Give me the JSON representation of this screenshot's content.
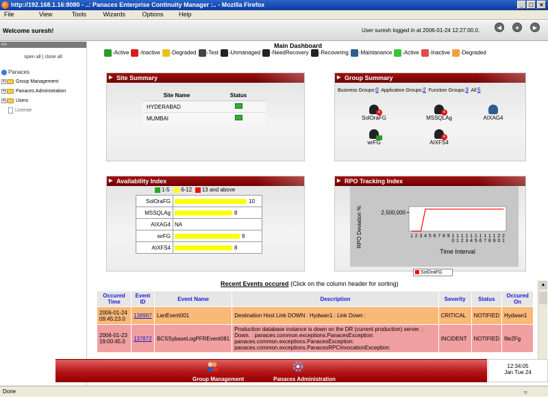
{
  "window": {
    "title": "http://192.168.1.16:8080 - ..: Panaces Enterprise Continuity Manager :.. - Mozilla Firefox"
  },
  "menu": [
    "File",
    "View",
    "Tools",
    "Wizards",
    "Options",
    "Help"
  ],
  "header": {
    "welcome": "Welcome suresh!",
    "login_info": "User suresh logged in at 2006-01-24 12:27:00.0."
  },
  "sidebar": {
    "strip": "<>",
    "open_all": "open all",
    "separator": "|",
    "close_all": "close all",
    "root": "Panaces",
    "items": [
      {
        "label": "Group Management"
      },
      {
        "label": "Panaces Administration"
      },
      {
        "label": "Users"
      },
      {
        "label": "License"
      }
    ]
  },
  "dashboard": {
    "title": "Main Dashboard",
    "legend": [
      {
        "label": "-Active",
        "color": "#2c9a2c"
      },
      {
        "label": "-Inactive",
        "color": "#d81b1b"
      },
      {
        "label": "-Degraded",
        "color": "#e6c21a"
      },
      {
        "label": "-Test",
        "color": "#444444"
      },
      {
        "label": "-Unmanaged",
        "color": "#222222"
      },
      {
        "label": "-NeedRecovery",
        "color": "#222222"
      },
      {
        "label": "-Recovering",
        "color": "#222222"
      },
      {
        "label": "-Maintanance",
        "color": "#2e5c8f"
      },
      {
        "label": "-Active",
        "color": "#37c537"
      },
      {
        "label": "-Inactive",
        "color": "#e24a4a"
      },
      {
        "label": "-Degraded",
        "color": "#f0a040"
      }
    ]
  },
  "site_summary": {
    "title": "Site Summary",
    "col_site": "Site Name",
    "col_status": "Status",
    "rows": [
      {
        "name": "HYDERABAD",
        "status_icon": "active-site-icon"
      },
      {
        "name": "MUMBAI",
        "status_icon": "active-site-icon"
      }
    ]
  },
  "group_summary": {
    "title": "Group Summary",
    "business_label": "Business Groups:",
    "business_count": "0",
    "application_label": "Application Groups:",
    "application_count": "2",
    "function_label": "Function Groups:",
    "function_count": "3",
    "all_label": "All:",
    "all_count": "5",
    "groups": [
      {
        "name": "SolOraFG",
        "state": "inactive"
      },
      {
        "name": "MSSQLAg",
        "state": "inactive"
      },
      {
        "name": "AIXAG4",
        "state": "maintanance"
      },
      {
        "name": "wrFG",
        "state": "active"
      },
      {
        "name": "AIXFS4",
        "state": "inactive"
      }
    ]
  },
  "availability": {
    "title": "Availability Index",
    "legend": [
      {
        "label": "1-5",
        "color": "#22aa22"
      },
      {
        "label": "6-12",
        "color": "#ffff00"
      },
      {
        "label": "13 and above",
        "color": "#ee1111"
      }
    ],
    "rows": [
      {
        "name": "SolOraFG",
        "value": 10,
        "label": "10"
      },
      {
        "name": "MSSQLAg",
        "value": 8,
        "label": "8"
      },
      {
        "name": "AIXAG4",
        "value": null,
        "label": "NA"
      },
      {
        "name": "wrFG",
        "value": 9,
        "label": "9"
      },
      {
        "name": "AIXFS4",
        "value": 8,
        "label": "8"
      }
    ]
  },
  "chart_data": {
    "type": "line",
    "title": "RPO Tracking Index",
    "xlabel": "Time Interval",
    "ylabel": "RPO Deviation %",
    "ytick": "2,500,000",
    "x": [
      "1",
      "2",
      "3",
      "4",
      "5",
      "6",
      "7",
      "8",
      "9",
      "10",
      "11",
      "12",
      "13",
      "14",
      "15",
      "16",
      "17",
      "18",
      "19",
      "20",
      "21"
    ],
    "series": [
      {
        "name": "SolOraFG",
        "color": "#ff0000",
        "values": [
          0,
          0,
          0,
          2950000,
          2950000,
          2950000,
          2950000,
          2950000,
          2950000,
          2950000,
          2950000,
          2950000,
          2950000,
          2950000,
          2950000,
          2950000,
          2950000,
          2950000,
          2950000,
          2950000,
          2950000
        ]
      }
    ],
    "ylim": [
      0,
      3300000
    ],
    "grid": false,
    "legend": "bottom"
  },
  "events": {
    "title": "Recent Events occured",
    "hint": "(Click on the column header for sorting)",
    "columns": [
      "Occured Time",
      "Event ID",
      "Event Name",
      "Description",
      "Severity",
      "Status",
      "Occured On"
    ],
    "rows": [
      {
        "time": "2006-01-24 09:45:23.0",
        "id": "138987",
        "name": "LanEvent001",
        "description": "Destination Host Link DOWN : Hydwan1 : Link Down :",
        "severity": "CRITICAL",
        "status": "NOTIFIED",
        "on": "Hydwan1"
      },
      {
        "time": "2006-01-23 19:00:45.0",
        "id": "137872",
        "name": "BCSSybaseLogPFREvent081",
        "description": "Production database instance is down on the DR (current production) server. : Down. : panaces.common.exceptions.PanacesException: panaces.common.exceptions.PanacesException: panaces.common.exceptions.PanacesRPCInvocationException:",
        "severity": "INCIDENT",
        "status": "NOTIFIED",
        "on": "file2Fg"
      }
    ]
  },
  "bottom": {
    "group_management": "Group Management",
    "panaces_administration": "Panaces Administration",
    "clock_time": "12:34:05",
    "clock_date": "Jan Tue 24"
  },
  "status": {
    "text": "Done"
  }
}
